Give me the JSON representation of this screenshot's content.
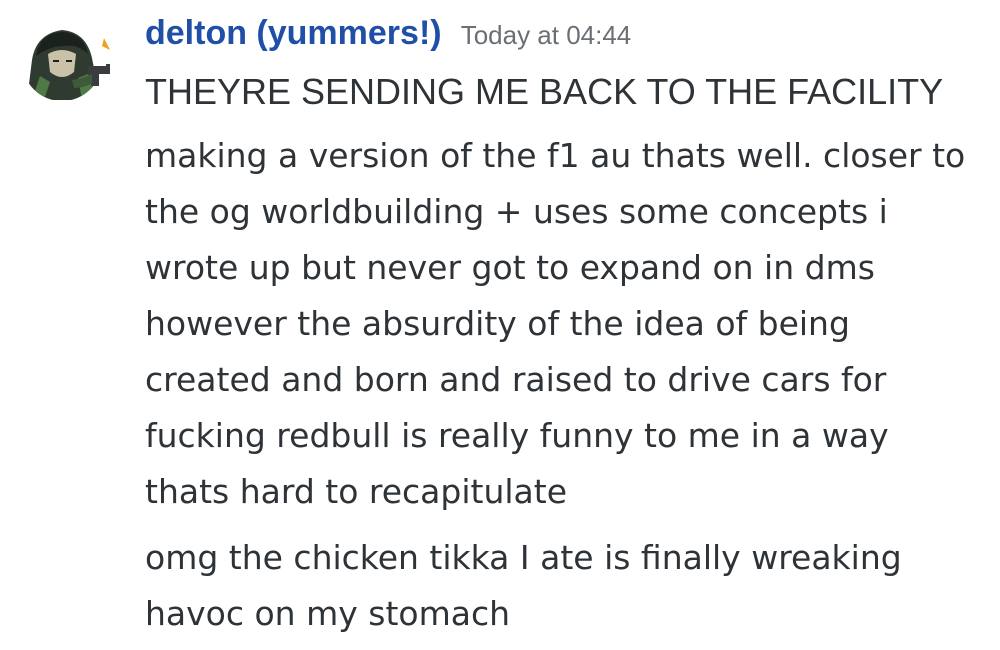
{
  "author": {
    "name": "delton (yummers!)",
    "name_color": "#1f4fa6",
    "avatar_icon": "avatar-character-with-gun"
  },
  "timestamp": "Today at 04:44",
  "messages": [
    {
      "text": "THEYRE SENDING ME BACK TO THE FACILITY"
    },
    {
      "text": "making a version of the f1 au thats well. closer to\nthe og worldbuilding + uses some concepts i\nwrote up but never got to expand on in dms\nhowever the absurdity of the idea of being\ncreated and born and raised to drive cars for\nfucking redbull is really funny to me in a way\nthats hard to recapitulate"
    },
    {
      "text": "omg the chicken tikka I ate is finally wreaking\nhavoc on my stomach"
    }
  ]
}
